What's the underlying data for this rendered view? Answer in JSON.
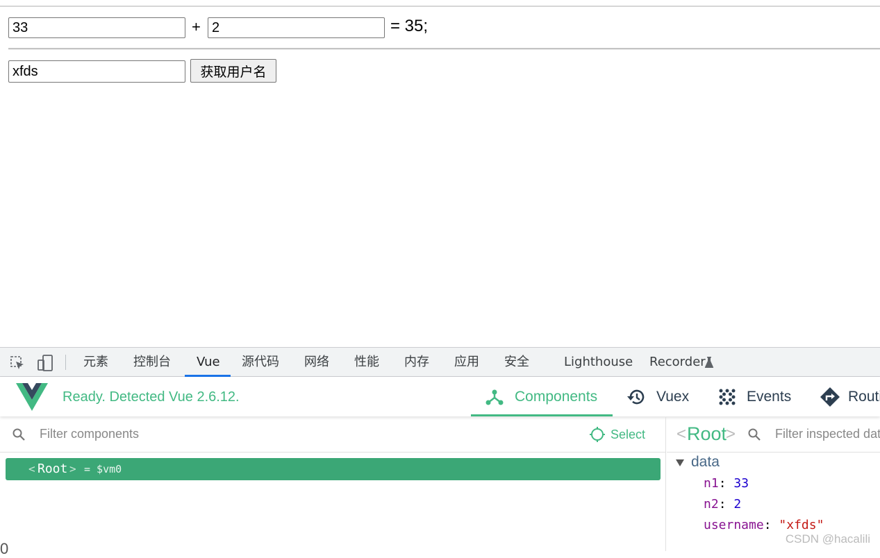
{
  "page": {
    "n1_value": "33",
    "plus": "+",
    "n2_value": "2",
    "result": "= 35;",
    "username_value": "xfds",
    "get_username_button": "获取用户名"
  },
  "devtools": {
    "tabs": [
      "元素",
      "控制台",
      "Vue",
      "源代码",
      "网络",
      "性能",
      "内存",
      "应用",
      "安全",
      "Lighthouse",
      "Recorder"
    ],
    "active_tab": "Vue"
  },
  "vue_devtools": {
    "status": "Ready. Detected Vue 2.6.12.",
    "tabs": [
      "Components",
      "Vuex",
      "Events",
      "Routi"
    ],
    "active_tab": "Components",
    "filter_placeholder": "Filter components",
    "select_label": "Select",
    "root_open": "<",
    "root_name": "Root",
    "root_close": ">",
    "root_suffix": "= $vm0",
    "inspector": {
      "title_open": "<",
      "title_name": "Root",
      "title_close": ">",
      "filter_placeholder": "Filter inspected dat",
      "section": "data",
      "fields": [
        {
          "key": "n1",
          "value": "33"
        },
        {
          "key": "n2",
          "value": "2"
        },
        {
          "key": "username",
          "value": "\"xfds\""
        }
      ]
    },
    "colors": {
      "accent": "#42b983",
      "row": "#3ba776"
    }
  },
  "left_edge_glyph": "0",
  "watermark": "CSDN @hacalili"
}
